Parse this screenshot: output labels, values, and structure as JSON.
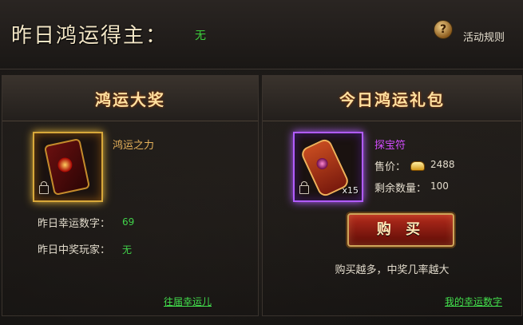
{
  "header": {
    "title": "昨日鸿运得主：",
    "winner": "无",
    "rules_label": "活动规则",
    "help_icon": "?"
  },
  "left_panel": {
    "title": "鸿运大奖",
    "item_name": "鸿运之力",
    "lucky_number_label": "昨日幸运数字：",
    "lucky_number_value": "69",
    "winner_player_label": "昨日中奖玩家：",
    "winner_player_value": "无",
    "link": "往届幸运儿"
  },
  "right_panel": {
    "title": "今日鸿运礼包",
    "item_name": "探宝符",
    "quantity_badge": "x15",
    "price_label": "售价：",
    "price_value": "2488",
    "remaining_label": "剩余数量：",
    "remaining_value": "100",
    "buy_button": "购 买",
    "hint": "购买越多，中奖几率越大",
    "link": "我的幸运数字"
  },
  "colors": {
    "gold_text": "#e8b35b",
    "green_text": "#41d24a",
    "purple_text": "#d44cff",
    "title_text": "#ffe0a0"
  },
  "icons": [
    "help-icon",
    "lock-icon",
    "gold-ingot-icon"
  ]
}
